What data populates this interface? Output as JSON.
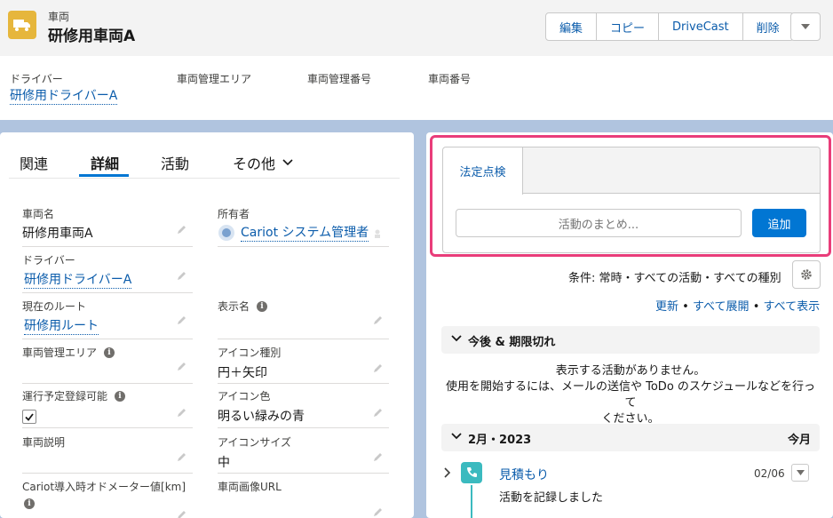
{
  "header": {
    "object_label": "車両",
    "record_title": "研修用車両A",
    "buttons": [
      "編集",
      "コピー",
      "DriveCast",
      "削除"
    ],
    "icon": "truck-icon",
    "more_icon": "chevron-down-icon"
  },
  "highlights": {
    "driver_label": "ドライバー",
    "driver_value": "研修用ドライバーA",
    "area_label": "車両管理エリア",
    "mgmt_no_label": "車両管理番号",
    "vehicle_no_label": "車両番号"
  },
  "tabs": {
    "related": "関連",
    "details": "詳細",
    "activity": "活動",
    "more": "その他"
  },
  "fields": {
    "vehicle_name_label": "車両名",
    "vehicle_name_value": "研修用車両A",
    "owner_label": "所有者",
    "owner_value": "Cariot システム管理者",
    "driver_label": "ドライバー",
    "driver_value": "研修用ドライバーA",
    "route_label": "現在のルート",
    "route_value": "研修用ルート",
    "display_name_label": "表示名",
    "area_label": "車両管理エリア",
    "icon_type_label": "アイコン種別",
    "icon_type_value": "円＋矢印",
    "schedule_label": "運行予定登録可能",
    "schedule_checked": true,
    "icon_color_label": "アイコン色",
    "icon_color_value": "明るい緑みの青",
    "desc_label": "車両説明",
    "icon_size_label": "アイコンサイズ",
    "icon_size_value": "中",
    "odometer_label": "Cariot導入時オドメーター値[km]",
    "image_url_label": "車両画像URL"
  },
  "publisher": {
    "tab_label": "法定点検",
    "input_placeholder": "活動のまとめ...",
    "add_button": "追加"
  },
  "activity": {
    "filter_text": "条件: 常時・すべての活動・すべての種別",
    "refresh": "更新",
    "expand_all": "すべて展開",
    "show_all": "すべて表示",
    "separator": "•",
    "upcoming_title": "今後 & 期限切れ",
    "empty_line1": "表示する活動がありません。",
    "empty_line2": "使用を開始するには、メールの送信や ToDo のスケジュールなどを行って",
    "empty_line3": "ください。",
    "month_title": "2月・2023",
    "month_badge": "今月",
    "item_title": "見積もり",
    "item_subtitle": "活動を記録しました",
    "item_date": "02/06"
  },
  "colors": {
    "brand_blue": "#0176d3",
    "link_blue": "#0b5cab",
    "highlight_pink": "#e93d7a",
    "vehicle_icon": "#e6b63c",
    "log_call_icon": "#3bbabf"
  }
}
